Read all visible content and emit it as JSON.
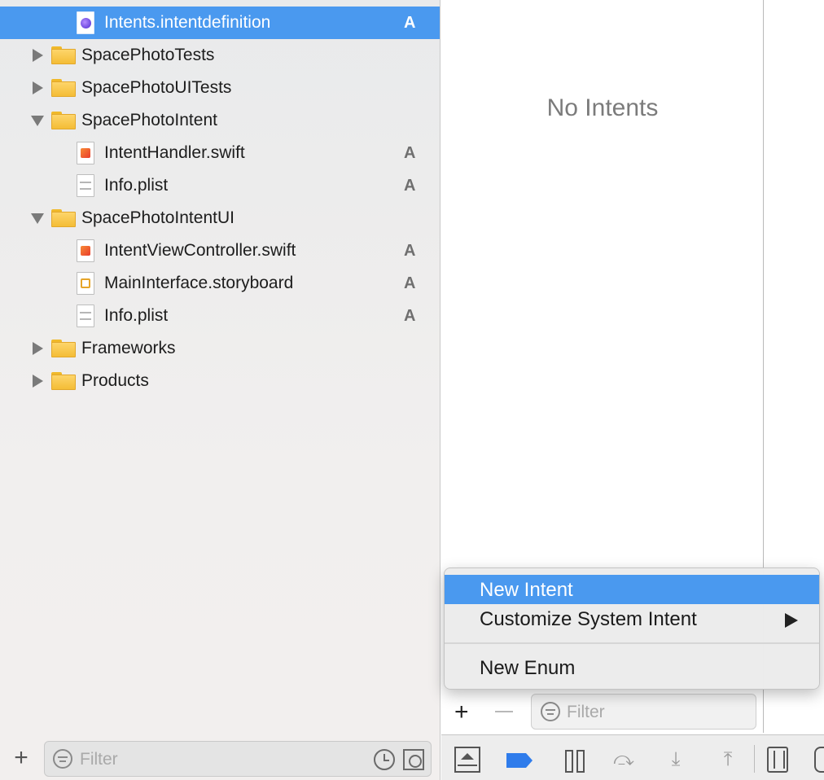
{
  "navigator": {
    "items": [
      {
        "label": "Intents.intentdefinition",
        "kind": "intents-file",
        "status": "A",
        "selected": true
      },
      {
        "label": "SpacePhotoTests",
        "kind": "folder",
        "expanded": false,
        "status": ""
      },
      {
        "label": "SpacePhotoUITests",
        "kind": "folder",
        "expanded": false,
        "status": ""
      },
      {
        "label": "SpacePhotoIntent",
        "kind": "folder",
        "expanded": true,
        "status": ""
      },
      {
        "label": "IntentHandler.swift",
        "kind": "swift-file",
        "status": "A"
      },
      {
        "label": "Info.plist",
        "kind": "plist-file",
        "status": "A"
      },
      {
        "label": "SpacePhotoIntentUI",
        "kind": "folder",
        "expanded": true,
        "status": ""
      },
      {
        "label": "IntentViewController.swift",
        "kind": "swift-file",
        "status": "A"
      },
      {
        "label": "MainInterface.storyboard",
        "kind": "storyboard-file",
        "status": "A"
      },
      {
        "label": "Info.plist",
        "kind": "plist-file",
        "status": "A"
      },
      {
        "label": "Frameworks",
        "kind": "folder",
        "expanded": false,
        "status": ""
      },
      {
        "label": "Products",
        "kind": "folder",
        "expanded": false,
        "status": ""
      }
    ],
    "add_icon": "plus-icon",
    "filter_placeholder": "Filter"
  },
  "editor": {
    "empty_label": "No Intents",
    "add_icon": "plus-icon",
    "remove_icon": "minus-icon",
    "filter_placeholder": "Filter"
  },
  "context_menu": {
    "items": [
      {
        "label": "New Intent",
        "highlighted": true
      },
      {
        "label": "Customize System Intent",
        "submenu": true
      },
      {
        "label": "New Enum"
      }
    ]
  },
  "debug_bar": {
    "icons": [
      "hide-debug-area-icon",
      "breakpoints-icon",
      "pause-icon",
      "step-over-icon",
      "step-into-icon",
      "step-out-icon",
      "view-hierarchy-icon",
      "simulate-location-icon"
    ]
  },
  "colors": {
    "selection": "#4a99ef",
    "breakpoint": "#2f7ceb"
  }
}
